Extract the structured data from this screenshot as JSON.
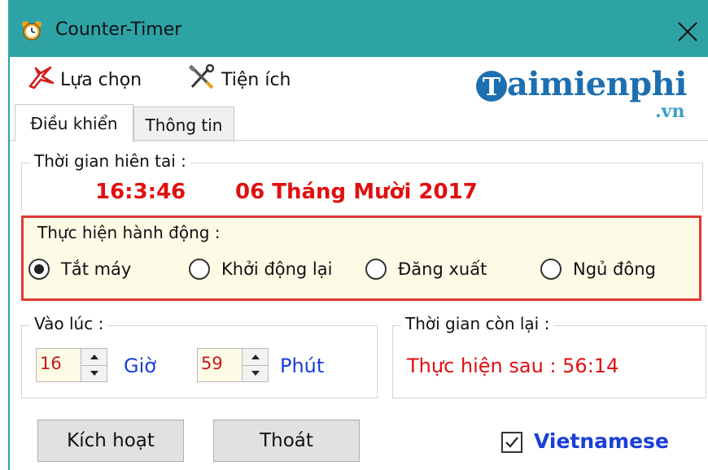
{
  "window": {
    "title": "Counter-Timer",
    "title_bar_color": "#2ea3a6",
    "app_icon": "alarm-clock-icon",
    "close_icon": "close-icon"
  },
  "menu": {
    "items": [
      {
        "label": "Lựa chọn",
        "icon": "options-icon"
      },
      {
        "label": "Tiện ích",
        "icon": "tools-icon"
      }
    ]
  },
  "brand": {
    "main": "aimienphi",
    "suffix": ".vn",
    "logo_letter": "T"
  },
  "tabs": [
    {
      "label": "Điều khiển",
      "active": true
    },
    {
      "label": "Thông tin",
      "active": false
    }
  ],
  "current_time": {
    "legend": "Thời gian hiên tai :",
    "time": "16:3:46",
    "date": "06 Tháng Mười 2017"
  },
  "action": {
    "legend": "Thực hiện hành động :",
    "options": [
      {
        "label": "Tắt máy",
        "selected": true
      },
      {
        "label": "Khởi động lại",
        "selected": false
      },
      {
        "label": "Đăng xuất",
        "selected": false
      },
      {
        "label": "Ngủ đông",
        "selected": false
      }
    ],
    "highlight_color": "#e53935"
  },
  "at_time": {
    "legend": "Vào lúc :",
    "hour_value": "16",
    "hour_label": "Giờ",
    "minute_value": "59",
    "minute_label": "Phút"
  },
  "remaining": {
    "legend": "Thời gian còn lại :",
    "text": "Thực hiện sau : 56:14"
  },
  "buttons": {
    "activate": "Kích hoạt",
    "exit": "Thoát"
  },
  "language": {
    "label": "Vietnamese",
    "checked": true
  },
  "colors": {
    "accent_red": "#e01010",
    "accent_blue": "#1a3fd8",
    "input_bg": "#fdfbe6"
  }
}
